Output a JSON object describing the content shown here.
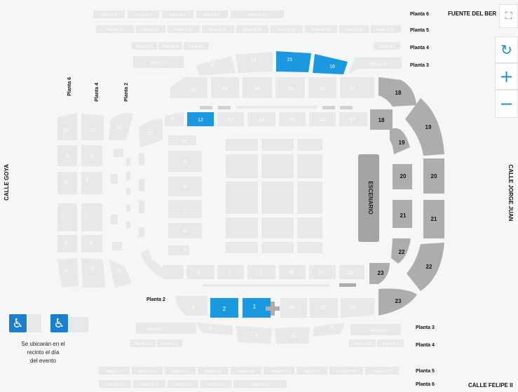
{
  "colors": {
    "available": "#e6e8ea",
    "selected": "#1a98e0",
    "premium": "#adadad",
    "stage": "#a3a3a3",
    "grey": "#cfd2d5"
  },
  "streets": {
    "top": "FUENTE DEL BER",
    "bottom": "CALLE FELIPE II",
    "left": "CALLE GOYA",
    "right": "CALLE JORGE JUAN"
  },
  "floor_labels": {
    "p6_top": "Planta 6",
    "p5_top": "Planta 5",
    "p4_top": "Planta 4",
    "p3_top": "Planta 3",
    "p3_bottom": "Planta 3",
    "p4_bottom": "Planta 4",
    "p5_bottom": "Planta 5",
    "p6_bottom": "Planta 6",
    "planta2_bottom": "Planta 2",
    "v_p6": "Planta 6",
    "v_p4": "Planta 4",
    "v_p2": "Planta 2"
  },
  "stage_label": "ESCENARIO",
  "note_lines": [
    "Se ubicarán en el",
    "recinto el día",
    "del evento"
  ],
  "controls": {
    "fullscreen": "⛶",
    "reset": "↻",
    "zoom_in": "+",
    "zoom_out": "−"
  },
  "accessibility_icon": "wheelchair-icon",
  "palcos": {
    "top_p6": [
      "Palco 6.6",
      "Palco 6.7",
      "Palco 6.8",
      "Palco 6.9",
      "Palco 5.10"
    ],
    "top_p5": [
      "Palco 5.8",
      "Palco 5.9",
      "Palco 5.10",
      "Palco 5.11",
      "Palco 5.12",
      "Palco 5.13",
      "Palco 5.14",
      "Palco 5.15",
      "Palco 5.16"
    ],
    "top_p4": [
      "Palco 4.3",
      "Palco 4.4",
      "Palco 4.5",
      "Palco 4.6"
    ],
    "top_p3": [
      "Palco 3.2",
      "Palco 3.3"
    ],
    "bottom_p3": [
      "Palco 3.1",
      "Palco 3.4"
    ],
    "bottom_p4": [
      "Palco 4.2",
      "Palco 4.1",
      "Palco 4.8",
      "Palco 4.7"
    ],
    "bottom_p5": [
      "Palco 5.7",
      "Palco 5.6",
      "Palco 5.5",
      "Palco 5.4",
      "Palco 5.3",
      "Palco 5.2",
      "Palco 5.1",
      "Palco 5.18",
      "Palco 5.17"
    ],
    "bottom_p6": [
      "Palco 6.5",
      "Palco 6.4",
      "Palco 6.3",
      "Palco 6.2",
      "Palco 6.1"
    ]
  },
  "sections": {
    "upper_top": [
      "15",
      "14",
      "15",
      "16",
      "15"
    ],
    "mid_top": [
      "12",
      "13",
      "14",
      "15",
      "16",
      "17"
    ],
    "low_top": [
      "11",
      "12",
      "13",
      "14",
      "15",
      "16",
      "17"
    ],
    "right_dark": [
      "18",
      "18",
      "19",
      "19",
      "20",
      "20",
      "21",
      "21",
      "22",
      "22",
      "23",
      "23"
    ],
    "left_outer": [
      "10",
      "10",
      "10",
      "9",
      "9",
      "8",
      "8",
      "7",
      "7",
      "6",
      "6",
      "5",
      "5",
      "5"
    ],
    "left_inner": [
      "10",
      "10",
      "9",
      "8",
      "7",
      "6",
      "5",
      "4"
    ],
    "low_bottom": [
      "3",
      "2",
      "1",
      "26",
      "25",
      "24"
    ],
    "mid_bottom": [
      "3",
      "2",
      "1",
      "26",
      "25",
      "24"
    ],
    "upper_bottom": [
      "2",
      "1",
      "26",
      "25"
    ]
  }
}
